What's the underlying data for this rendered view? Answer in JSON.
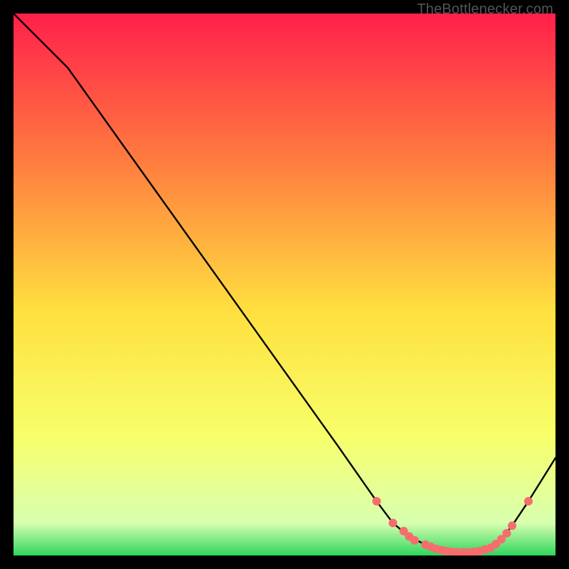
{
  "watermark": "TheBottlenecker.com",
  "chart_data": {
    "type": "line",
    "title": "",
    "xlabel": "",
    "ylabel": "",
    "xlim": [
      0,
      100
    ],
    "ylim": [
      0,
      100
    ],
    "background_gradient": {
      "top": "#ff1f4b",
      "mid_high": "#ff7f3f",
      "mid": "#ffe03f",
      "mid_low": "#f7ff6a",
      "low": "#d8ffb0",
      "bottom": "#2fd65d"
    },
    "curve": {
      "name": "bottleneck-curve",
      "x": [
        0,
        10,
        20,
        30,
        40,
        50,
        60,
        67,
        70,
        73,
        76,
        78,
        80,
        82,
        84,
        86,
        88,
        90,
        92,
        95,
        100
      ],
      "y": [
        100,
        90,
        76,
        62,
        48,
        34,
        20,
        10,
        6,
        3.5,
        2,
        1.2,
        0.8,
        0.6,
        0.6,
        0.8,
        1.4,
        3,
        5.5,
        10,
        18
      ]
    },
    "markers": {
      "name": "highlight-points",
      "color": "#f76c6c",
      "x": [
        67,
        70,
        72,
        73,
        74,
        76,
        77,
        78,
        79,
        80,
        81,
        82,
        83,
        84,
        85,
        86,
        87,
        88,
        89,
        90,
        91,
        92,
        95
      ],
      "y": [
        10,
        6,
        4.5,
        3.5,
        2.8,
        2,
        1.6,
        1.2,
        1.0,
        0.8,
        0.7,
        0.6,
        0.6,
        0.6,
        0.7,
        0.8,
        1.1,
        1.4,
        2.1,
        3,
        4.1,
        5.5,
        10
      ]
    }
  }
}
